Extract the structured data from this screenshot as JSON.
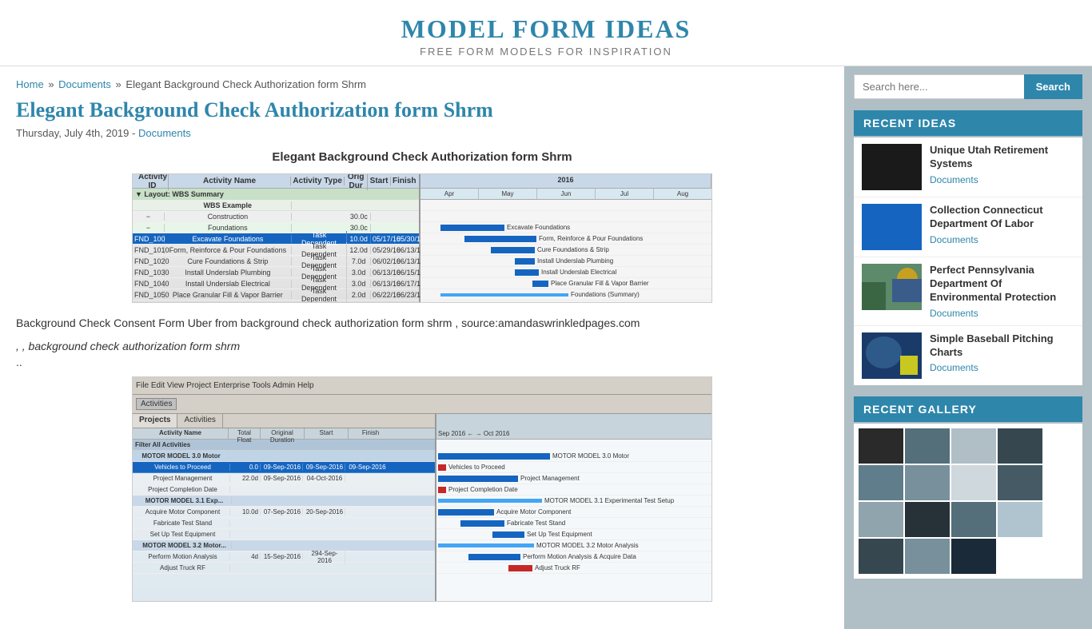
{
  "site": {
    "title": "MODEL FORM IDEAS",
    "tagline": "FREE FORM MODELS FOR INSPIRATION"
  },
  "header_nav": {
    "home": "Home",
    "documents": "Documents",
    "current_page": "Elegant Background Check Authorization form Shrm"
  },
  "article": {
    "title": "Elegant Background Check Authorization form Shrm",
    "date": "Thursday, July 4th, 2019 -",
    "category_link": "Documents",
    "section_title": "Elegant Background Check Authorization form Shrm",
    "body_text": "Background Check Consent Form Uber from background check authorization form shrm , source:amandaswrinkledpages.com",
    "body_italic": ", , background check authorization form shrm",
    "body_dots": ".."
  },
  "sidebar": {
    "search_placeholder": "Search here...",
    "search_button": "Search",
    "recent_ideas_title": "RECENT IDEAS",
    "recent_gallery_title": "RECENT GALLERY",
    "ideas": [
      {
        "title": "Unique Utah Retirement Systems",
        "category": "Documents",
        "thumb_type": "dark"
      },
      {
        "title": "Collection Connecticut Department Of Labor",
        "category": "Documents",
        "thumb_type": "blue"
      },
      {
        "title": "Perfect Pennsylvania Department Of Environmental Protection",
        "category": "Documents",
        "thumb_type": "photo"
      },
      {
        "title": "Simple Baseball Pitching Charts",
        "category": "Documents",
        "thumb_type": "sport"
      }
    ]
  }
}
